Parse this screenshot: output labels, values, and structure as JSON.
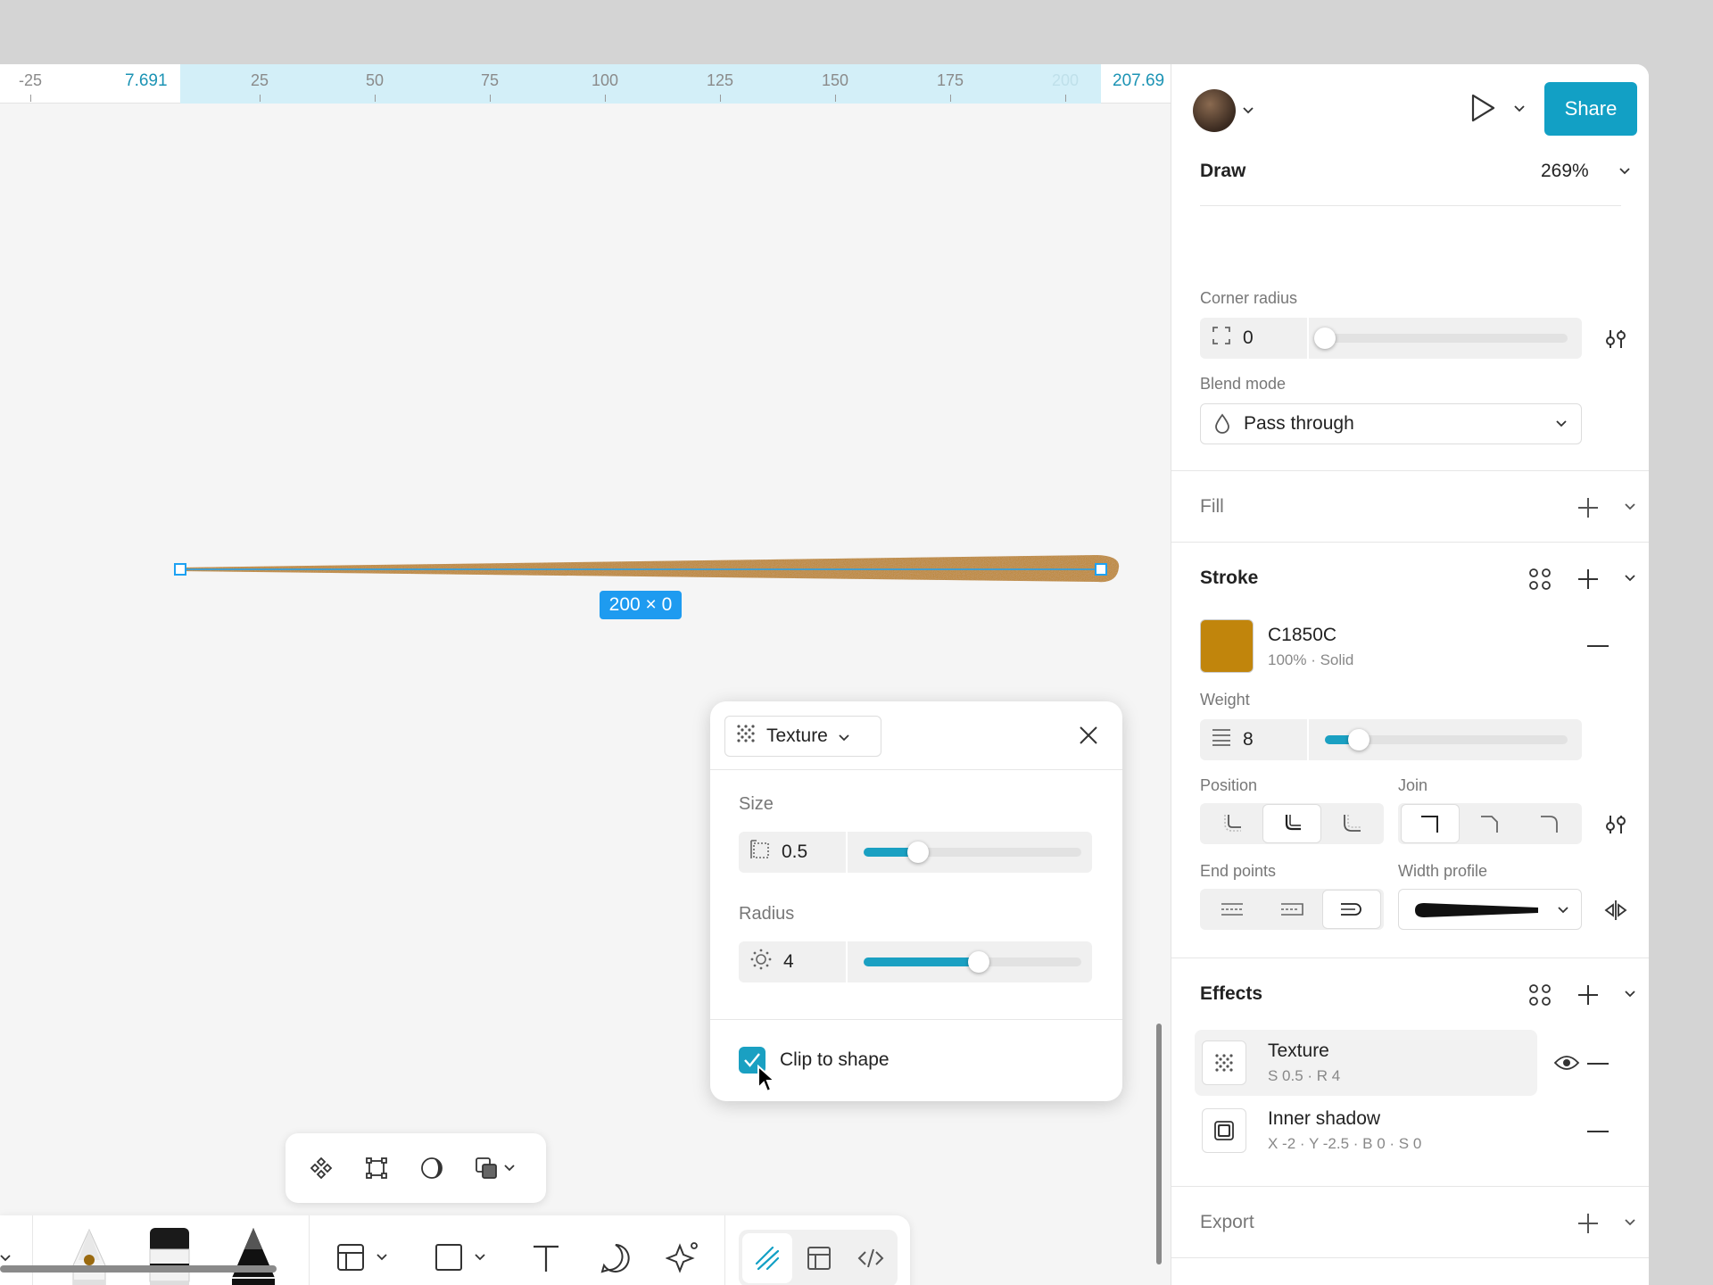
{
  "ruler": {
    "ticks": [
      "-25",
      "25",
      "50",
      "75",
      "100",
      "125",
      "150",
      "175",
      "200"
    ],
    "start_coord": "7.691",
    "end_coord": "207.69"
  },
  "canvas": {
    "dimension_label": "200 × 0",
    "stroke_color": "#C1850C"
  },
  "texture_popup": {
    "effect_type": "Texture",
    "size_label": "Size",
    "size_value": "0.5",
    "size_slider_fraction": 0.25,
    "radius_label": "Radius",
    "radius_value": "4",
    "radius_slider_fraction": 0.53,
    "clip_label": "Clip to shape",
    "clip_checked": true
  },
  "header": {
    "mode": "Draw",
    "zoom": "269%",
    "share_label": "Share"
  },
  "layer": {
    "corner_radius_label": "Corner radius",
    "corner_radius_value": "0",
    "corner_radius_fraction": 0.0,
    "blend_mode_label": "Blend mode",
    "blend_mode_value": "Pass through"
  },
  "fill": {
    "title": "Fill"
  },
  "stroke": {
    "title": "Stroke",
    "color_hex": "C1850C",
    "color_detail": "100% · Solid",
    "weight_label": "Weight",
    "weight_value": "8",
    "weight_fraction": 0.14,
    "position_label": "Position",
    "join_label": "Join",
    "endpoints_label": "End points",
    "width_profile_label": "Width profile"
  },
  "effects": {
    "title": "Effects",
    "items": [
      {
        "name": "Texture",
        "detail": "S 0.5 · R 4"
      },
      {
        "name": "Inner shadow",
        "detail": "X -2 · Y -2.5 · B 0 · S 0"
      }
    ]
  },
  "export": {
    "title": "Export"
  },
  "colors": {
    "accent": "#12A0C5",
    "selection": "#1E9BF0"
  }
}
